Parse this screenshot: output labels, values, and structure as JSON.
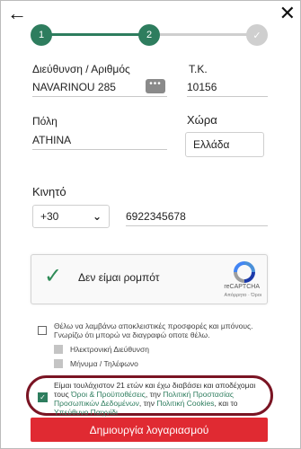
{
  "nav": {
    "back_icon": "←",
    "close_icon": "✕"
  },
  "stepper": {
    "steps": [
      "1",
      "2",
      "✓"
    ]
  },
  "address": {
    "street_label": "Διεύθυνση / Αριθμός",
    "street_value": "NAVARINOU 285",
    "street_btn": "•••",
    "postal_label": "Τ.Κ.",
    "postal_value": "10156",
    "city_label": "Πόλη",
    "city_value": "ATHINA",
    "country_label": "Χώρα",
    "country_value": "Ελλάδα"
  },
  "phone": {
    "label": "Κινητό",
    "code": "+30",
    "number": "6922345678"
  },
  "captcha": {
    "text": "Δεν είμαι ρομπότ",
    "brand": "reCAPTCHA",
    "terms": "Απόρρητο · Όροι"
  },
  "marketing": {
    "text": "Θέλω να λαμβάνω αποκλειστικές προσφορές και μπόνους. Γνωρίζω ότι μπορώ να διαγραφώ οποτε θέλω.",
    "option_email": "Ηλεκτρονική Διεύθυνση",
    "option_sms": "Μήνυμα / Τηλέφωνο"
  },
  "consent": {
    "text_1": "Είμαι τουλάχιστον 21 ετών και έχω διαβάσει και αποδέχομαι τους ",
    "link_terms": "Όροι & Προϋποθέσεις",
    "text_2": ", την ",
    "link_privacy": "Πολιτική Προστασίας Προσωπικών Δεδομένων",
    "text_3": ", την ",
    "link_cookies": "Πολιτική Cookies",
    "text_4": ", και το ",
    "link_gaming": "Υπεύθυνο Παιχνίδι"
  },
  "submit_label": "Δημιουργία λογαριασμού",
  "colors": {
    "accent": "#2e7d5e",
    "submit": "#e02a32",
    "highlight": "#7a1423"
  }
}
